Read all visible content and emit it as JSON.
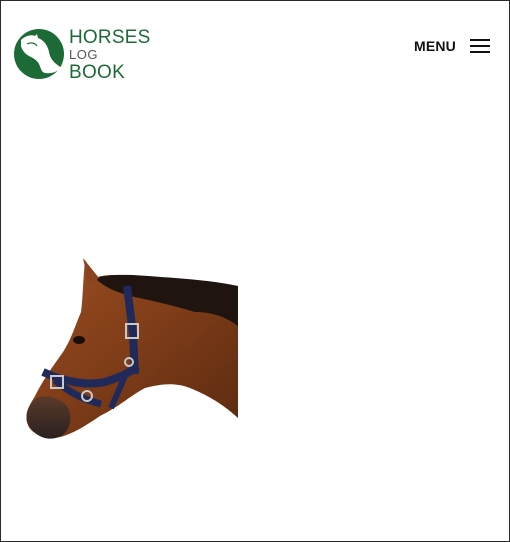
{
  "header": {
    "logo": {
      "line1": "HORSES",
      "line2": "LOG",
      "line3": "BOOK"
    },
    "menu_label": "MENU"
  },
  "colors": {
    "brand_green": "#1c6b36",
    "text_dark": "#111111",
    "background": "#ffffff"
  },
  "icons": {
    "logo": "horse-head-logo-icon",
    "menu": "hamburger-menu-icon"
  },
  "hero": {
    "image": "horse-head-with-halter"
  }
}
